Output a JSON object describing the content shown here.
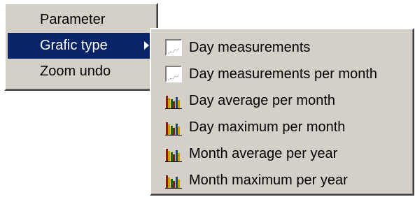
{
  "main_menu": {
    "items": [
      {
        "label": "Parameter"
      },
      {
        "label": "Grafic type",
        "highlighted": true,
        "has_submenu": true
      },
      {
        "label": "Zoom undo"
      }
    ]
  },
  "submenu": {
    "items": [
      {
        "label": "Day measurements",
        "icon": "line-graph-icon"
      },
      {
        "label": "Day measurements per month",
        "icon": "line-graph-icon"
      },
      {
        "label": "Day average per month",
        "icon": "bar-chart-icon"
      },
      {
        "label": "Day maximum per month",
        "icon": "bar-chart-icon"
      },
      {
        "label": "Month average per year",
        "icon": "bar-chart-icon"
      },
      {
        "label": "Month maximum per year",
        "icon": "bar-chart-icon"
      }
    ]
  },
  "colors": {
    "menu_background": "#d4d0c8",
    "highlight": "#0a246a",
    "text": "#000000",
    "highlight_text": "#ffffff"
  }
}
